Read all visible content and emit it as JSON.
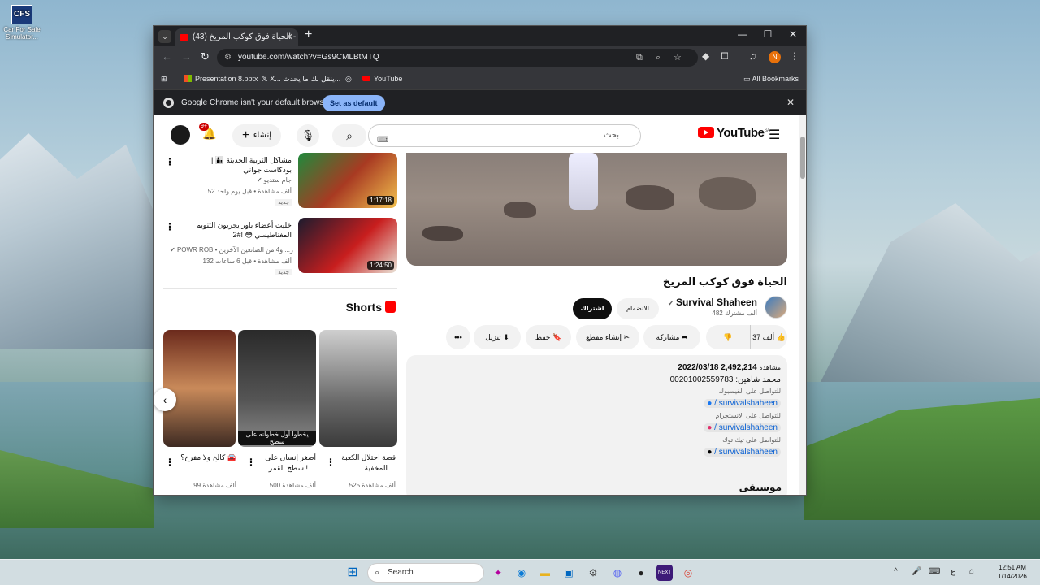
{
  "desktop": {
    "icon_label": "Car For Sale Simulator...",
    "icon_short": "CFS"
  },
  "browser": {
    "tab_title": "(43) الحياة فوق كوكب المريخ -",
    "url": "youtube.com/watch?v=Gs9CMLBtMTQ",
    "bookmarks": [
      "Presentation 8.pptx",
      "X... ينقل لك ما يحدث...",
      "YouTube"
    ],
    "all_bookmarks": "All Bookmarks",
    "infobar_text": "Google Chrome isn't your default browser",
    "set_default": "Set as default",
    "profile_initial": "N"
  },
  "youtube": {
    "logo": "YouTube",
    "region": "SA",
    "search_placeholder": "بحث",
    "create_label": "إنشاء",
    "notif_count": "9+",
    "video_title": "الحياة فوق كوكب المريخ",
    "channel": {
      "name": "Survival Shaheen",
      "subs": "482 ألف مشترك",
      "join": "الانضمام",
      "subscribe": "اشتراك"
    },
    "actions": {
      "likes": "37 ألف",
      "share": "مشاركة",
      "clip": "إنشاء مقطع",
      "save": "حفظ",
      "download": "تنزيل"
    },
    "description": {
      "views": "2,492,214",
      "views_label": "مشاهدة",
      "date": "2022/03/18",
      "contact": "محمد شاهين: 00201002559783",
      "fb_label": "للتواصل على الفيسبوك",
      "fb_link": "/ survivalshaheen",
      "ig_label": "للتواصل على الانستجرام",
      "ig_link": "/ survivalshaheen",
      "tt_label": "للتواصل على تيك توك",
      "tt_link": "/ survivalshaheen",
      "music": "موسيقى"
    },
    "related": [
      {
        "title": "مشاكل التربية الحديثة 👨‍👦 | بودكاست جواني",
        "channel": "جام ستديو",
        "meta": "52 ألف مشاهدة • قبل يوم واحد",
        "badge": "جديد",
        "duration": "1:17:18"
      },
      {
        "title": "خليت أعضاء باور يجربون التنويم المغناطيسي 😳 !#2",
        "channel": "POWR ROB • ر... و4 من الصانعين الآخرين",
        "meta": "132 ألف مشاهدة • قبل 6 ساعات",
        "badge": "جديد",
        "duration": "1:24:50"
      }
    ],
    "shorts_title": "Shorts",
    "shorts": [
      {
        "title": "قصة احتلال الكعبة المخفية ...",
        "views": "525 ألف مشاهدة",
        "caption": ""
      },
      {
        "title": "أصغر إنسان على سطح القمر ! ...",
        "views": "500 ألف مشاهدة",
        "caption": "يخطوا أول خطوانه على سطح"
      },
      {
        "title": "كالح ولا مفرح؟ 🚘",
        "views": "99 ألف مشاهدة",
        "caption": ""
      }
    ]
  },
  "taskbar": {
    "search": "Search",
    "time": "12:51 AM",
    "date": "1/14/2026"
  }
}
